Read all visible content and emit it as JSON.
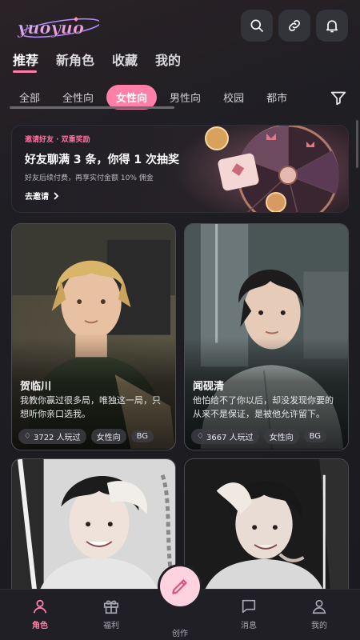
{
  "header": {
    "logo_text": "yuoyuo"
  },
  "main_tabs": [
    {
      "label": "推荐"
    },
    {
      "label": "新角色"
    },
    {
      "label": "收藏"
    },
    {
      "label": "我的"
    }
  ],
  "filters": [
    {
      "label": "全部"
    },
    {
      "label": "全性向"
    },
    {
      "label": "女性向"
    },
    {
      "label": "男性向"
    },
    {
      "label": "校园"
    },
    {
      "label": "都市"
    }
  ],
  "banner": {
    "tag": "邀请好友 · 双重奖励",
    "title": "好友聊满 3 条，你得 1 次抽奖",
    "subtitle": "好友后续付费，再享实付金额 10% 佣金",
    "link": "去邀请"
  },
  "cards": [
    {
      "name": "贺临川",
      "desc": "我教你赢过很多局，唯独这一局，只想听你亲口选我。",
      "plays": "3722 人玩过",
      "tag": "女性向",
      "type": "BG"
    },
    {
      "name": "闻砚清",
      "desc": "他怕给不了你以后，却没发现你要的从来不是保证，是被他允许留下。",
      "plays": "3667 人玩过",
      "tag": "女性向",
      "type": "BG"
    },
    {
      "name": "",
      "desc": "",
      "plays": "",
      "tag": "",
      "type": ""
    },
    {
      "name": "",
      "desc": "",
      "plays": "",
      "tag": "",
      "type": ""
    }
  ],
  "nav": [
    {
      "label": "角色"
    },
    {
      "label": "福利"
    },
    {
      "label": "创作"
    },
    {
      "label": "消息"
    },
    {
      "label": "我的"
    }
  ],
  "colors": {
    "accent": "#ff7fa8",
    "background": "#1b1b20"
  }
}
